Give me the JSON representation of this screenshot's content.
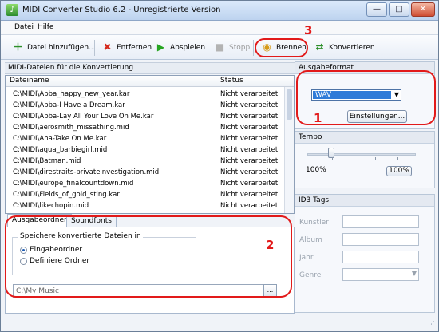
{
  "titlebar": {
    "title": "MIDI Converter Studio 6.2  -  Unregistrierte Version"
  },
  "menubar": {
    "items": [
      "Datei",
      "Hilfe"
    ]
  },
  "toolbar": {
    "add_label": "Datei hinzufügen...",
    "remove_label": "Entfernen",
    "play_label": "Abspielen",
    "stop_label": "Stopp",
    "burn_label": "Brennen",
    "convert_label": "Konvertieren"
  },
  "file_section": {
    "title": "MIDI-Dateien für die Konvertierung",
    "columns": {
      "name": "Dateiname",
      "status": "Status"
    },
    "rows": [
      {
        "name": "C:\\MIDI\\Abba_happy_new_year.kar",
        "status": "Nicht verarbeitet"
      },
      {
        "name": "C:\\MIDI\\Abba-I Have a Dream.kar",
        "status": "Nicht verarbeitet"
      },
      {
        "name": "C:\\MIDI\\Abba-Lay All Your Love On Me.kar",
        "status": "Nicht verarbeitet"
      },
      {
        "name": "C:\\MIDI\\aerosmith_missathing.mid",
        "status": "Nicht verarbeitet"
      },
      {
        "name": "C:\\MIDI\\Aha-Take On Me.kar",
        "status": "Nicht verarbeitet"
      },
      {
        "name": "C:\\MIDI\\aqua_barbiegirl.mid",
        "status": "Nicht verarbeitet"
      },
      {
        "name": "C:\\MIDI\\Batman.mid",
        "status": "Nicht verarbeitet"
      },
      {
        "name": "C:\\MIDI\\direstraits-privateinvestigation.mid",
        "status": "Nicht verarbeitet"
      },
      {
        "name": "C:\\MIDI\\europe_finalcountdown.mid",
        "status": "Nicht verarbeitet"
      },
      {
        "name": "C:\\MIDI\\Fields_of_gold_sting.kar",
        "status": "Nicht verarbeitet"
      },
      {
        "name": "C:\\MIDI\\likechopin.mid",
        "status": "Nicht verarbeitet"
      }
    ]
  },
  "output_tabs": {
    "tab_output": "Ausgabeordner",
    "tab_soundfonts": "Soundfonts",
    "group_label": "Speichere konvertierte Dateien in",
    "radio_input": "Eingabeordner",
    "radio_define": "Definiere Ordner",
    "path_value": "C:\\My Music",
    "browse_label": "..."
  },
  "format_panel": {
    "title": "Ausgabeformat",
    "selected": "WAV",
    "settings_button": "Einstellungen..."
  },
  "tempo_panel": {
    "title": "Tempo",
    "value": "100%",
    "reset_button": "100%",
    "slider_level": 0.22
  },
  "id3_panel": {
    "title": "ID3 Tags",
    "fields": [
      "Künstler",
      "Album",
      "Jahr",
      "Genre"
    ]
  },
  "annotations": {
    "one": "1",
    "two": "2",
    "three": "3"
  },
  "colors": {
    "annotation": "#e21a1a",
    "selection": "#2f7bd8"
  }
}
